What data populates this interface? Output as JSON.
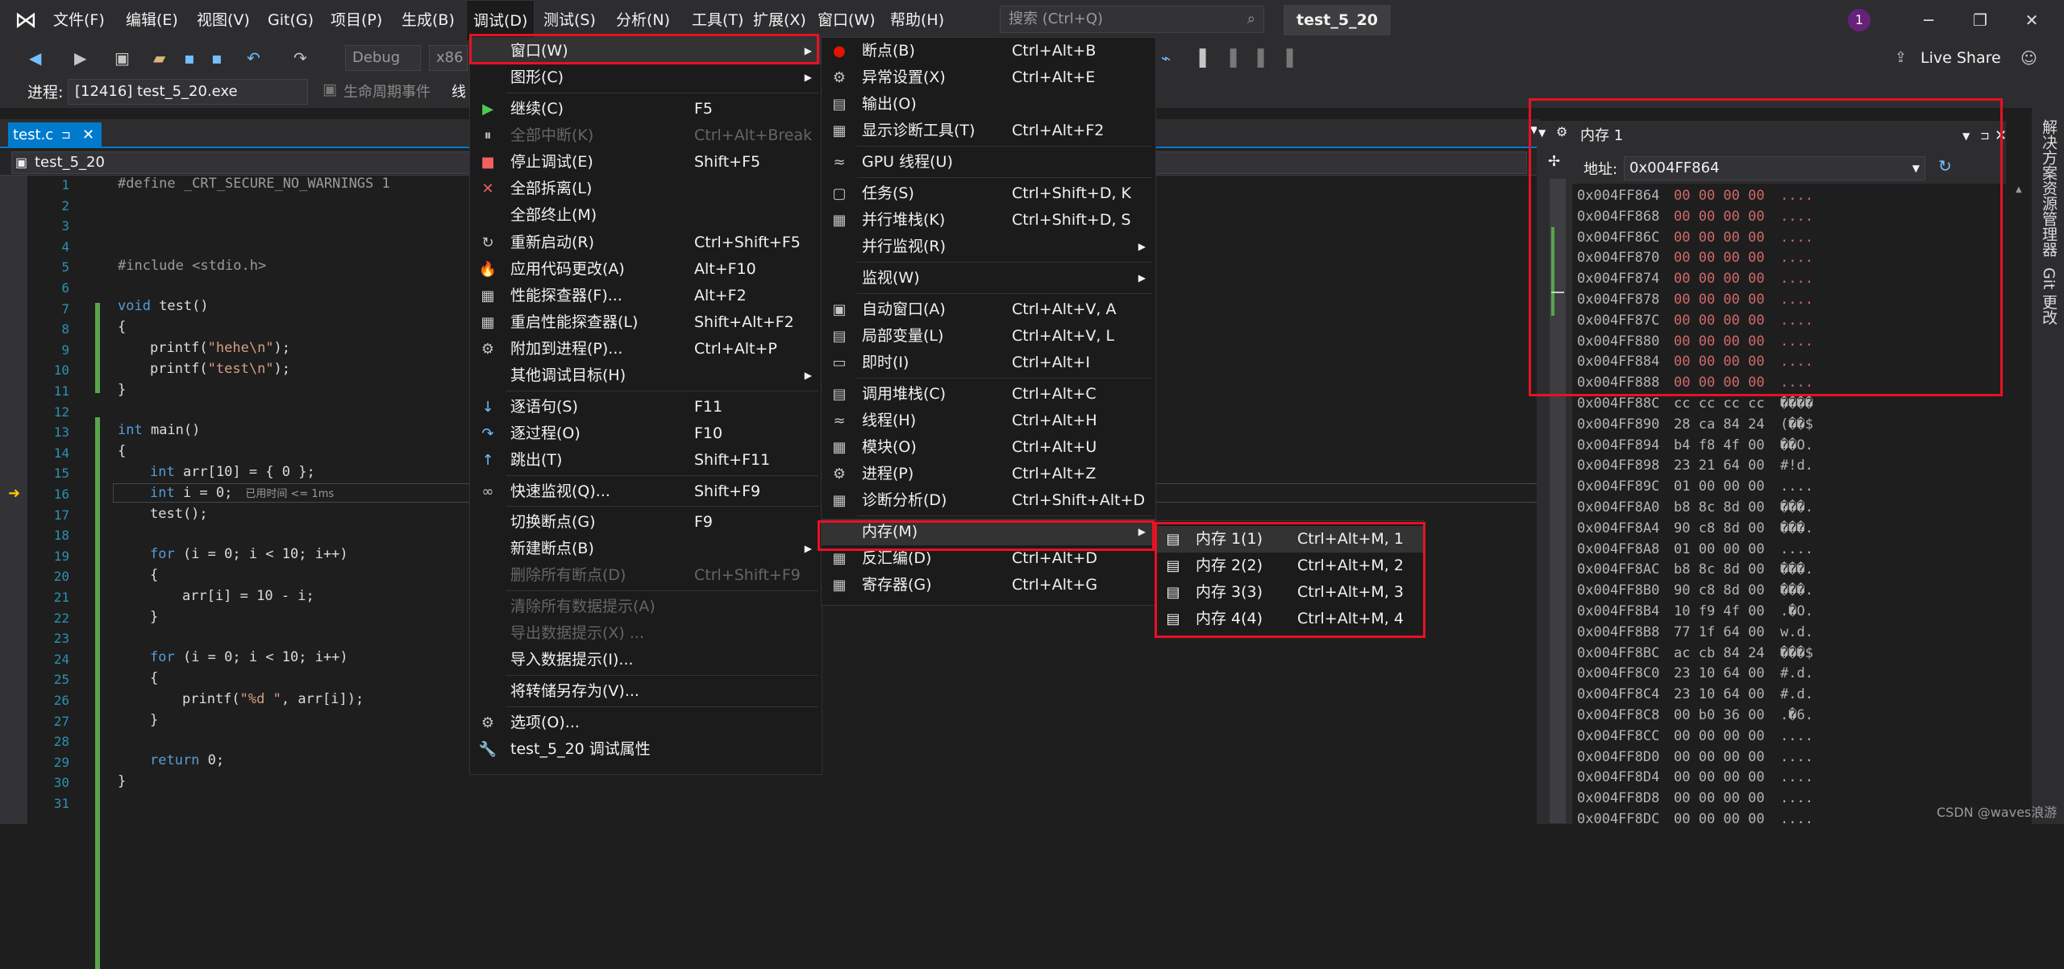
{
  "menubar": {
    "items": [
      "文件(F)",
      "编辑(E)",
      "视图(V)",
      "Git(G)",
      "项目(P)",
      "生成(B)",
      "调试(D)",
      "测试(S)",
      "分析(N)",
      "工具(T)",
      "扩展(X)",
      "窗口(W)",
      "帮助(H)"
    ]
  },
  "search": {
    "placeholder": "搜索 (Ctrl+Q)"
  },
  "project_title": "test_5_20",
  "notif_count": "1",
  "live_share": "Live Share",
  "toolbar": {
    "config": "Debug",
    "platform": "x86",
    "process_label": "进程:",
    "process_value": "[12416] test_5_20.exe",
    "lifecycle": "生命周期事件",
    "thread": "线"
  },
  "tab": {
    "label": "test.c",
    "pin": "⊐"
  },
  "navbar": {
    "scope": "test_5_20"
  },
  "code": {
    "lines": [
      "1",
      "2",
      "3",
      "4",
      "5",
      "6",
      "7",
      "8",
      "9",
      "10",
      "11",
      "12",
      "13",
      "14",
      "15",
      "16",
      "17",
      "18",
      "19",
      "20",
      "21",
      "22",
      "23",
      "24",
      "25",
      "26",
      "27",
      "28",
      "29",
      "30",
      "31"
    ],
    "l1": "#define _CRT_SECURE_NO_WARNINGS 1",
    "l5": "#include <stdio.h>",
    "l7": "void test()",
    "l8": "{",
    "l9": "printf(\"hehe\\n\");",
    "l10": "printf(\"test\\n\");",
    "l11": "}",
    "l13": "int main()",
    "l14": "{",
    "l15": "int arr[10] = { 0 };",
    "l16": "int i = 0;",
    "l16hint": "已用时间 <= 1ms",
    "l17": "test();",
    "l19": "for (i = 0; i < 10; i++)",
    "l20": "{",
    "l21": "arr[i] = 10 - i;",
    "l22": "}",
    "l24": "for (i = 0; i < 10; i++)",
    "l25": "{",
    "l26": "printf(\"%d \", arr[i]);",
    "l27": "}",
    "l29": "return 0;",
    "l30": "}"
  },
  "debug_menu": {
    "items": [
      {
        "label": "窗口(W)",
        "shortcut": ""
      },
      {
        "label": "图形(C)",
        "shortcut": ""
      },
      {
        "label": "继续(C)",
        "shortcut": "F5"
      },
      {
        "label": "全部中断(K)",
        "shortcut": "Ctrl+Alt+Break"
      },
      {
        "label": "停止调试(E)",
        "shortcut": "Shift+F5"
      },
      {
        "label": "全部拆离(L)",
        "shortcut": ""
      },
      {
        "label": "全部终止(M)",
        "shortcut": ""
      },
      {
        "label": "重新启动(R)",
        "shortcut": "Ctrl+Shift+F5"
      },
      {
        "label": "应用代码更改(A)",
        "shortcut": "Alt+F10"
      },
      {
        "label": "性能探查器(F)...",
        "shortcut": "Alt+F2"
      },
      {
        "label": "重启性能探查器(L)",
        "shortcut": "Shift+Alt+F2"
      },
      {
        "label": "附加到进程(P)...",
        "shortcut": "Ctrl+Alt+P"
      },
      {
        "label": "其他调试目标(H)",
        "shortcut": ""
      },
      {
        "label": "逐语句(S)",
        "shortcut": "F11"
      },
      {
        "label": "逐过程(O)",
        "shortcut": "F10"
      },
      {
        "label": "跳出(T)",
        "shortcut": "Shift+F11"
      },
      {
        "label": "快速监视(Q)...",
        "shortcut": "Shift+F9"
      },
      {
        "label": "切换断点(G)",
        "shortcut": "F9"
      },
      {
        "label": "新建断点(B)",
        "shortcut": ""
      },
      {
        "label": "删除所有断点(D)",
        "shortcut": "Ctrl+Shift+F9"
      },
      {
        "label": "清除所有数据提示(A)",
        "shortcut": ""
      },
      {
        "label": "导出数据提示(X) ...",
        "shortcut": ""
      },
      {
        "label": "导入数据提示(I)...",
        "shortcut": ""
      },
      {
        "label": "将转储另存为(V)...",
        "shortcut": ""
      },
      {
        "label": "选项(O)...",
        "shortcut": ""
      },
      {
        "label": "test_5_20 调试属性",
        "shortcut": ""
      }
    ]
  },
  "window_menu": {
    "items": [
      {
        "label": "断点(B)",
        "shortcut": "Ctrl+Alt+B"
      },
      {
        "label": "异常设置(X)",
        "shortcut": "Ctrl+Alt+E"
      },
      {
        "label": "输出(O)",
        "shortcut": ""
      },
      {
        "label": "显示诊断工具(T)",
        "shortcut": "Ctrl+Alt+F2"
      },
      {
        "label": "GPU 线程(U)",
        "shortcut": ""
      },
      {
        "label": "任务(S)",
        "shortcut": "Ctrl+Shift+D, K"
      },
      {
        "label": "并行堆栈(K)",
        "shortcut": "Ctrl+Shift+D, S"
      },
      {
        "label": "并行监视(R)",
        "shortcut": ""
      },
      {
        "label": "监视(W)",
        "shortcut": ""
      },
      {
        "label": "自动窗口(A)",
        "shortcut": "Ctrl+Alt+V, A"
      },
      {
        "label": "局部变量(L)",
        "shortcut": "Ctrl+Alt+V, L"
      },
      {
        "label": "即时(I)",
        "shortcut": "Ctrl+Alt+I"
      },
      {
        "label": "调用堆栈(C)",
        "shortcut": "Ctrl+Alt+C"
      },
      {
        "label": "线程(H)",
        "shortcut": "Ctrl+Alt+H"
      },
      {
        "label": "模块(O)",
        "shortcut": "Ctrl+Alt+U"
      },
      {
        "label": "进程(P)",
        "shortcut": "Ctrl+Alt+Z"
      },
      {
        "label": "诊断分析(D)",
        "shortcut": "Ctrl+Shift+Alt+D"
      },
      {
        "label": "内存(M)",
        "shortcut": ""
      },
      {
        "label": "反汇编(D)",
        "shortcut": "Ctrl+Alt+D"
      },
      {
        "label": "寄存器(G)",
        "shortcut": "Ctrl+Alt+G"
      }
    ]
  },
  "memory_menu": {
    "items": [
      {
        "label": "内存 1(1)",
        "shortcut": "Ctrl+Alt+M, 1"
      },
      {
        "label": "内存 2(2)",
        "shortcut": "Ctrl+Alt+M, 2"
      },
      {
        "label": "内存 3(3)",
        "shortcut": "Ctrl+Alt+M, 3"
      },
      {
        "label": "内存 4(4)",
        "shortcut": "Ctrl+Alt+M, 4"
      }
    ]
  },
  "memory_window": {
    "title": "内存 1",
    "addr_label": "地址:",
    "addr_value": "0x004FF864",
    "rows": [
      {
        "a": "0x004FF864",
        "h": "00 00 00 00",
        "t": "...."
      },
      {
        "a": "0x004FF868",
        "h": "00 00 00 00",
        "t": "...."
      },
      {
        "a": "0x004FF86C",
        "h": "00 00 00 00",
        "t": "...."
      },
      {
        "a": "0x004FF870",
        "h": "00 00 00 00",
        "t": "...."
      },
      {
        "a": "0x004FF874",
        "h": "00 00 00 00",
        "t": "...."
      },
      {
        "a": "0x004FF878",
        "h": "00 00 00 00",
        "t": "...."
      },
      {
        "a": "0x004FF87C",
        "h": "00 00 00 00",
        "t": "...."
      },
      {
        "a": "0x004FF880",
        "h": "00 00 00 00",
        "t": "...."
      },
      {
        "a": "0x004FF884",
        "h": "00 00 00 00",
        "t": "...."
      },
      {
        "a": "0x004FF888",
        "h": "00 00 00 00",
        "t": "...."
      },
      {
        "a": "0x004FF88C",
        "h": "cc cc cc cc",
        "t": "����"
      },
      {
        "a": "0x004FF890",
        "h": "28 ca 84 24",
        "t": "(��$"
      },
      {
        "a": "0x004FF894",
        "h": "b4 f8 4f 00",
        "t": "��O."
      },
      {
        "a": "0x004FF898",
        "h": "23 21 64 00",
        "t": "#!d."
      },
      {
        "a": "0x004FF89C",
        "h": "01 00 00 00",
        "t": "...."
      },
      {
        "a": "0x004FF8A0",
        "h": "b8 8c 8d 00",
        "t": "���."
      },
      {
        "a": "0x004FF8A4",
        "h": "90 c8 8d 00",
        "t": "���."
      },
      {
        "a": "0x004FF8A8",
        "h": "01 00 00 00",
        "t": "...."
      },
      {
        "a": "0x004FF8AC",
        "h": "b8 8c 8d 00",
        "t": "���."
      },
      {
        "a": "0x004FF8B0",
        "h": "90 c8 8d 00",
        "t": "���."
      },
      {
        "a": "0x004FF8B4",
        "h": "10 f9 4f 00",
        "t": ".�O."
      },
      {
        "a": "0x004FF8B8",
        "h": "77 1f 64 00",
        "t": "w.d."
      },
      {
        "a": "0x004FF8BC",
        "h": "ac cb 84 24",
        "t": "���$"
      },
      {
        "a": "0x004FF8C0",
        "h": "23 10 64 00",
        "t": "#.d."
      },
      {
        "a": "0x004FF8C4",
        "h": "23 10 64 00",
        "t": "#.d."
      },
      {
        "a": "0x004FF8C8",
        "h": "00 b0 36 00",
        "t": ".�6."
      },
      {
        "a": "0x004FF8CC",
        "h": "00 00 00 00",
        "t": "...."
      },
      {
        "a": "0x004FF8D0",
        "h": "00 00 00 00",
        "t": "...."
      },
      {
        "a": "0x004FF8D4",
        "h": "00 00 00 00",
        "t": "...."
      },
      {
        "a": "0x004FF8D8",
        "h": "00 00 00 00",
        "t": "...."
      },
      {
        "a": "0x004FF8DC",
        "h": "00 00 00 00",
        "t": "...."
      }
    ]
  },
  "right_side": {
    "solution_explorer": "解决方案资源管理器",
    "git": "Git 更改"
  },
  "watermark": "CSDN @waves浪游"
}
